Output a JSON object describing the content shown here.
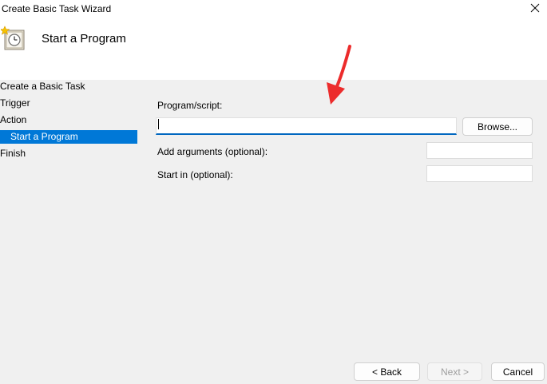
{
  "window": {
    "title": "Create Basic Task Wizard",
    "close_icon": "close-icon"
  },
  "header": {
    "icon": "task-clock-icon",
    "title": "Start a Program"
  },
  "nav": {
    "items": [
      {
        "label": "Create a Basic Task"
      },
      {
        "label": "Trigger"
      },
      {
        "label": "Action"
      },
      {
        "label": "Start a Program",
        "selected": true
      },
      {
        "label": "Finish"
      }
    ]
  },
  "form": {
    "program_label": "Program/script:",
    "program_value": "",
    "browse_label": "Browse...",
    "arguments_label": "Add arguments (optional):",
    "arguments_value": "",
    "startin_label": "Start in (optional):",
    "startin_value": ""
  },
  "footer": {
    "back_label": "< Back",
    "next_label": "Next >",
    "cancel_label": "Cancel"
  },
  "colors": {
    "selection": "#0078d7",
    "focus_underline": "#0067c0",
    "annotation_arrow": "#ec2b2b"
  }
}
